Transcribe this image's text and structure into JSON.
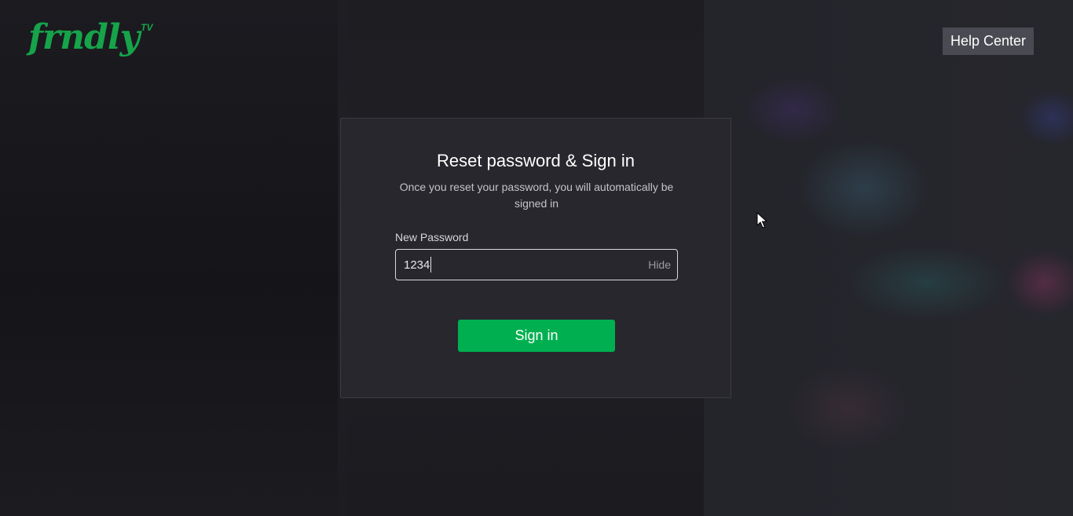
{
  "brand": {
    "logo_text": "frndly",
    "logo_superscript": "TV",
    "color": "#16a34a"
  },
  "header": {
    "help_center_label": "Help Center"
  },
  "card": {
    "title": "Reset password & Sign in",
    "subtitle": "Once you reset your password, you will automatically be signed in",
    "password_label": "New Password",
    "password_value": "1234",
    "toggle_label": "Hide",
    "submit_label": "Sign in",
    "submit_color": "#00b050"
  },
  "icons": {
    "mouse_cursor": "arrow-cursor-icon"
  }
}
